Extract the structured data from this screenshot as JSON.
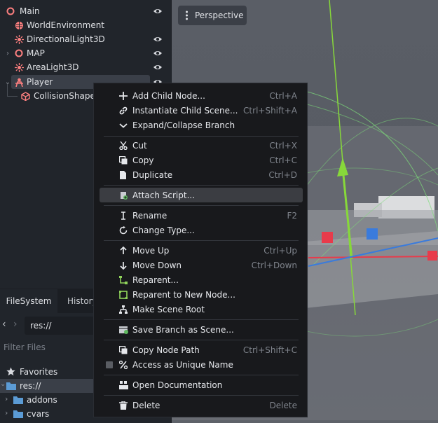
{
  "scene_tree": {
    "nodes": [
      {
        "label": "Main",
        "icon": "node3d-icon",
        "color": "#fc7f7f"
      },
      {
        "label": "WorldEnvironment",
        "icon": "world-environment-icon",
        "color": "#fc7f7f"
      },
      {
        "label": "DirectionalLight3D",
        "icon": "sun-icon",
        "color": "#fc7f7f"
      },
      {
        "label": "MAP",
        "icon": "node3d-icon",
        "color": "#fc7f7f"
      },
      {
        "label": "AreaLight3D",
        "icon": "sun-icon",
        "color": "#fc7f7f"
      },
      {
        "label": "Player",
        "icon": "character-icon",
        "color": "#fc7f7f"
      },
      {
        "label": "CollisionShape",
        "icon": "collision-shape-icon",
        "color": "#fc7f7f"
      }
    ]
  },
  "viewport": {
    "perspective_label": "Perspective"
  },
  "filesystem": {
    "tabs": [
      "FileSystem",
      "History"
    ],
    "path": "res://",
    "filter_placeholder": "Filter Files",
    "items": [
      {
        "label": "Favorites",
        "icon": "star-icon"
      },
      {
        "label": "res://",
        "icon": "folder-icon"
      },
      {
        "label": "addons",
        "icon": "folder-icon"
      },
      {
        "label": "cvars",
        "icon": "folder-icon"
      }
    ]
  },
  "context_menu": {
    "items": [
      {
        "label": "Add Child Node...",
        "shortcut": "Ctrl+A",
        "icon": "plus-icon"
      },
      {
        "label": "Instantiate Child Scene...",
        "shortcut": "Ctrl+Shift+A",
        "icon": "link-icon"
      },
      {
        "label": "Expand/Collapse Branch",
        "shortcut": "",
        "icon": "chevron-down-icon"
      },
      {
        "label": "Cut",
        "shortcut": "Ctrl+X",
        "icon": "scissors-icon"
      },
      {
        "label": "Copy",
        "shortcut": "Ctrl+C",
        "icon": "copy-icon"
      },
      {
        "label": "Duplicate",
        "shortcut": "Ctrl+D",
        "icon": "duplicate-icon"
      },
      {
        "label": "Attach Script...",
        "shortcut": "",
        "icon": "script-add-icon"
      },
      {
        "label": "Rename",
        "shortcut": "F2",
        "icon": "text-cursor-icon"
      },
      {
        "label": "Change Type...",
        "shortcut": "",
        "icon": "rotate-icon"
      },
      {
        "label": "Move Up",
        "shortcut": "Ctrl+Up",
        "icon": "arrow-up-icon"
      },
      {
        "label": "Move Down",
        "shortcut": "Ctrl+Down",
        "icon": "arrow-down-icon"
      },
      {
        "label": "Reparent...",
        "shortcut": "",
        "icon": "reparent-icon"
      },
      {
        "label": "Reparent to New Node...",
        "shortcut": "",
        "icon": "reparent-new-icon"
      },
      {
        "label": "Make Scene Root",
        "shortcut": "",
        "icon": "scene-root-icon"
      },
      {
        "label": "Save Branch as Scene...",
        "shortcut": "",
        "icon": "save-scene-icon"
      },
      {
        "label": "Copy Node Path",
        "shortcut": "Ctrl+Shift+C",
        "icon": "copy-path-icon"
      },
      {
        "label": "Access as Unique Name",
        "shortcut": "",
        "icon": "percent-icon"
      },
      {
        "label": "Open Documentation",
        "shortcut": "",
        "icon": "doc-icon"
      },
      {
        "label": "Delete",
        "shortcut": "Delete",
        "icon": "trash-icon"
      }
    ]
  },
  "colors": {
    "accent_node": "#fc7f7f",
    "folder": "#5b9bd5",
    "gizmo_x": "#e83b4b",
    "gizmo_y": "#87d83a",
    "gizmo_z": "#3a7bdc"
  }
}
